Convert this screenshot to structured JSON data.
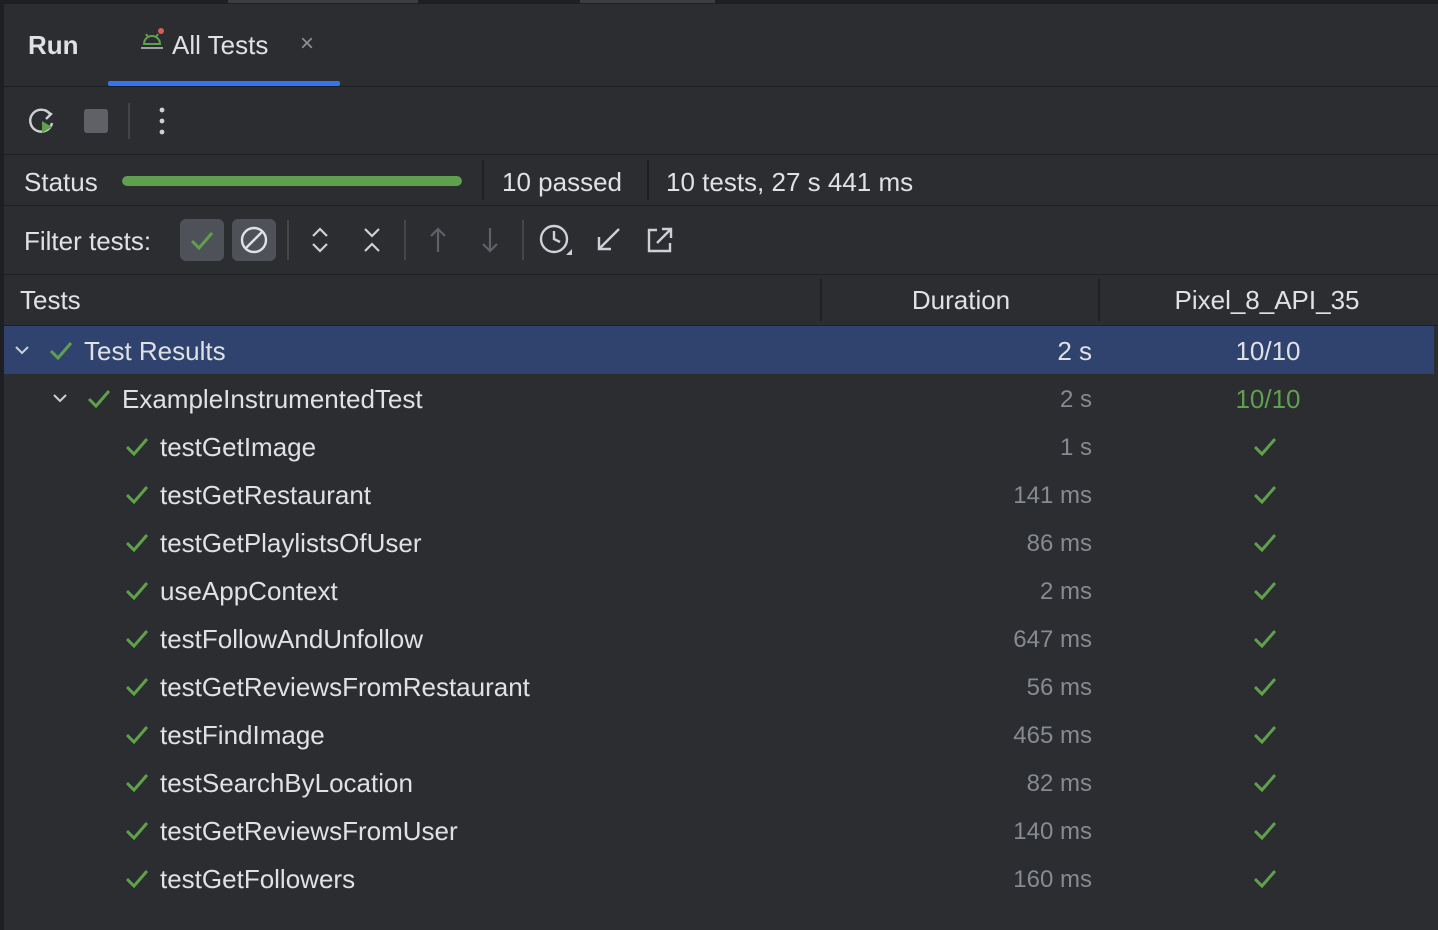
{
  "tabbar": {
    "run_label": "Run",
    "tab_label": "All Tests",
    "tab_close": "×",
    "accent": "#3574f0"
  },
  "toolbar": {
    "buttons": [
      "rerun-icon",
      "stop-icon",
      "more-icon"
    ]
  },
  "status": {
    "label": "Status",
    "progress_fraction": 1.0,
    "progress_color": "#5fa04e",
    "passed": "10 passed",
    "summary": "10 tests, 27 s 441 ms"
  },
  "filter": {
    "label": "Filter tests:",
    "buttons": [
      "show-passed-icon",
      "show-ignored-icon",
      "expand-all-icon",
      "collapse-all-icon",
      "previous-failed-icon",
      "next-failed-icon",
      "sort-by-duration-icon",
      "import-icon",
      "export-icon"
    ]
  },
  "table": {
    "columns": [
      "Tests",
      "Duration",
      "Pixel_8_API_35"
    ],
    "root": {
      "name": "Test Results",
      "duration": "2 s",
      "result": "10/10"
    },
    "suite": {
      "name": "ExampleInstrumentedTest",
      "duration": "2 s",
      "result": "10/10"
    },
    "tests": [
      {
        "name": "testGetImage",
        "duration": "1 s"
      },
      {
        "name": "testGetRestaurant",
        "duration": "141 ms"
      },
      {
        "name": "testGetPlaylistsOfUser",
        "duration": "86 ms"
      },
      {
        "name": "useAppContext",
        "duration": "2 ms"
      },
      {
        "name": "testFollowAndUnfollow",
        "duration": "647 ms"
      },
      {
        "name": "testGetReviewsFromRestaurant",
        "duration": "56 ms"
      },
      {
        "name": "testFindImage",
        "duration": "465 ms"
      },
      {
        "name": "testSearchByLocation",
        "duration": "82 ms"
      },
      {
        "name": "testGetReviewsFromUser",
        "duration": "140 ms"
      },
      {
        "name": "testGetFollowers",
        "duration": "160 ms"
      }
    ]
  },
  "colors": {
    "background": "#2b2d30",
    "selection": "#2f436e",
    "pass_green": "#5fa04e"
  }
}
